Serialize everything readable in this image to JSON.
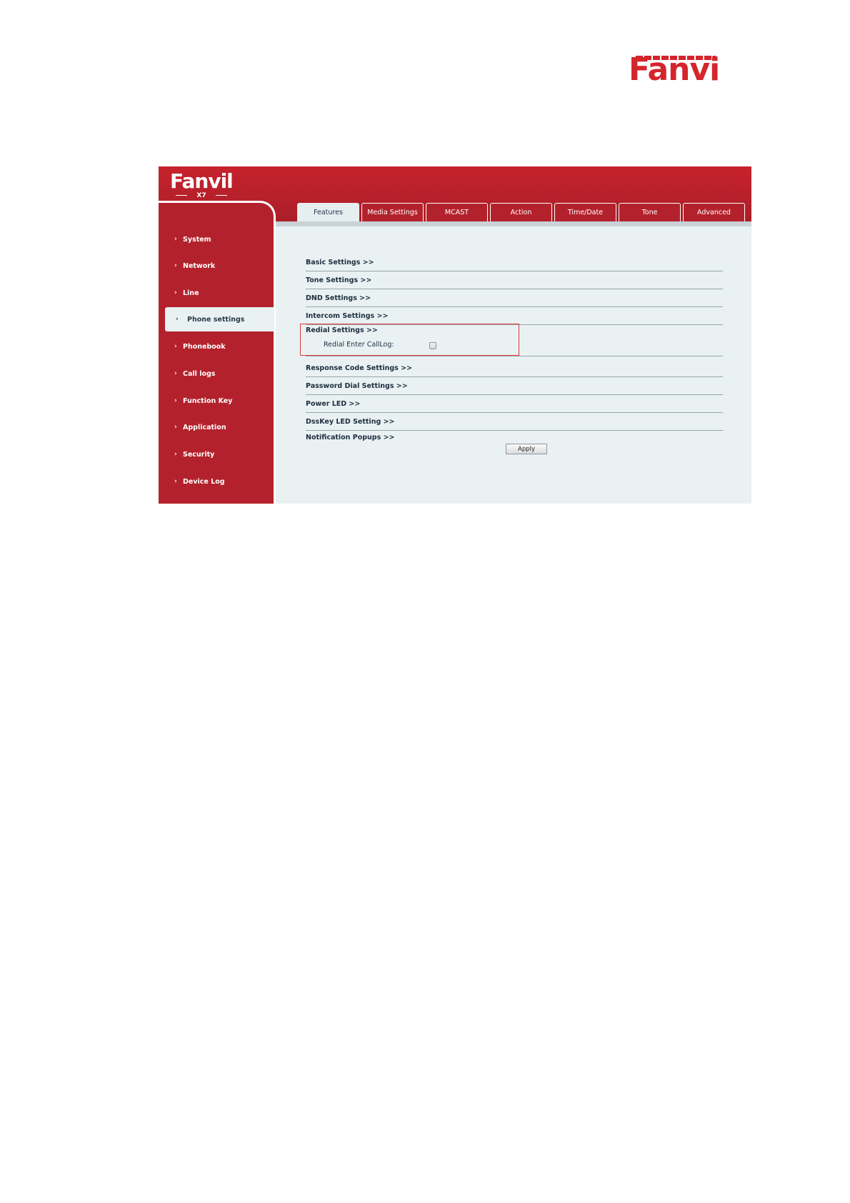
{
  "page_logo": "Fanvil",
  "app": {
    "logo": "Fanvil",
    "model": "X7"
  },
  "sidebar": {
    "items": [
      {
        "label": "System"
      },
      {
        "label": "Network"
      },
      {
        "label": "Line"
      },
      {
        "label": "Phone settings",
        "active": true
      },
      {
        "label": "Phonebook"
      },
      {
        "label": "Call logs"
      },
      {
        "label": "Function Key"
      },
      {
        "label": "Application"
      },
      {
        "label": "Security"
      },
      {
        "label": "Device Log"
      }
    ]
  },
  "tabs": [
    {
      "label": "Features",
      "active": true
    },
    {
      "label": "Media Settings"
    },
    {
      "label": "MCAST"
    },
    {
      "label": "Action"
    },
    {
      "label": "Time/Date"
    },
    {
      "label": "Tone"
    },
    {
      "label": "Advanced"
    }
  ],
  "sections": [
    {
      "label": "Basic Settings >>"
    },
    {
      "label": "Tone Settings >>"
    },
    {
      "label": "DND Settings >>"
    },
    {
      "label": "Intercom Settings >>"
    },
    {
      "label": "Redial Settings >>"
    },
    {
      "label": "Response Code Settings >>"
    },
    {
      "label": "Password Dial Settings >>"
    },
    {
      "label": "Power LED >>"
    },
    {
      "label": "DssKey LED Setting >>"
    },
    {
      "label": "Notification Popups >>"
    }
  ],
  "redial": {
    "field_label": "Redial Enter CallLog:",
    "checked": false
  },
  "apply_label": "Apply",
  "colors": {
    "brand_red": "#b3222c",
    "content_bg": "#e9f1f2",
    "highlight_box": "#e0383e"
  },
  "icons": {
    "nav_chevron": "chevron-right-icon"
  }
}
